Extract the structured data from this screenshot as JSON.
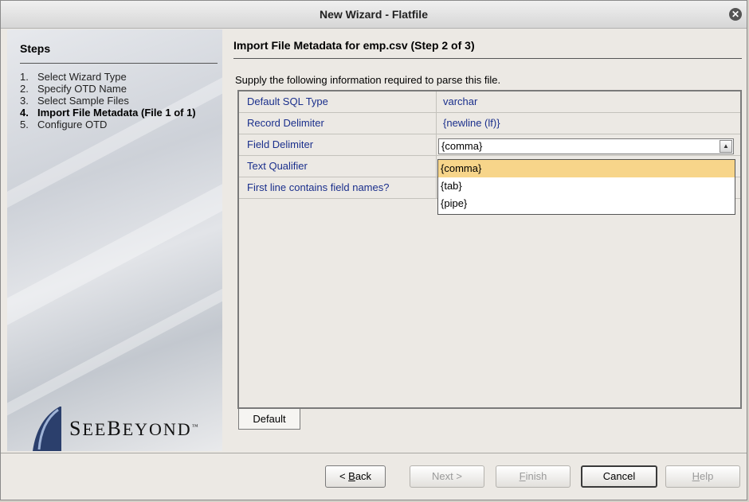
{
  "window": {
    "title": "New Wizard - Flatfile"
  },
  "steps": {
    "heading": "Steps",
    "items": [
      {
        "num": "1.",
        "label": "Select Wizard Type"
      },
      {
        "num": "2.",
        "label": "Specify OTD Name"
      },
      {
        "num": "3.",
        "label": "Select Sample Files"
      },
      {
        "num": "4.",
        "label": "Import File Metadata (File 1 of 1)"
      },
      {
        "num": "5.",
        "label": "Configure OTD"
      }
    ],
    "current_index": 3
  },
  "logo": {
    "first": "S",
    "rest1": "EE",
    "second": "B",
    "rest2": "EYOND",
    "tm": "™"
  },
  "main": {
    "heading": "Import File Metadata for emp.csv (Step 2 of 3)",
    "instructions": "Supply the following information required to parse this file.",
    "properties": [
      {
        "label": "Default SQL Type",
        "value": "varchar"
      },
      {
        "label": "Record Delimiter",
        "value": "{newline (lf)}"
      },
      {
        "label": "Field Delimiter",
        "value": "{comma}"
      },
      {
        "label": "Text Qualifier",
        "value": ""
      },
      {
        "label": "First line contains field names?",
        "value": ""
      }
    ],
    "combo": {
      "value": "{comma}"
    },
    "dropdown_options": [
      "{comma}",
      "{tab}",
      "{pipe}"
    ],
    "selected_option": "{comma}",
    "tab_label": "Default"
  },
  "buttons": {
    "back": {
      "pre": "< ",
      "mnemonic": "B",
      "post": "ack"
    },
    "next": "Next >",
    "finish": {
      "mnemonic": "F",
      "post": "inish"
    },
    "cancel": "Cancel",
    "help": {
      "mnemonic": "H",
      "post": "elp"
    }
  },
  "colors": {
    "label_text": "#1a2f8c",
    "selected_option_bg": "#f7d58a",
    "window_bg": "#ece9e4"
  }
}
